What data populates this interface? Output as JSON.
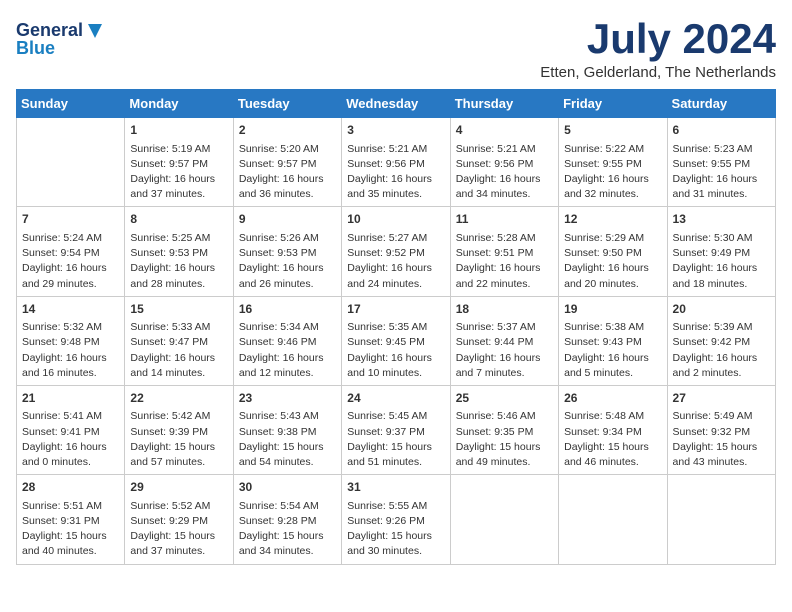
{
  "logo": {
    "line1": "General",
    "line2": "Blue"
  },
  "title": "July 2024",
  "location": "Etten, Gelderland, The Netherlands",
  "weekdays": [
    "Sunday",
    "Monday",
    "Tuesday",
    "Wednesday",
    "Thursday",
    "Friday",
    "Saturday"
  ],
  "weeks": [
    [
      {
        "day": "",
        "content": ""
      },
      {
        "day": "1",
        "content": "Sunrise: 5:19 AM\nSunset: 9:57 PM\nDaylight: 16 hours\nand 37 minutes."
      },
      {
        "day": "2",
        "content": "Sunrise: 5:20 AM\nSunset: 9:57 PM\nDaylight: 16 hours\nand 36 minutes."
      },
      {
        "day": "3",
        "content": "Sunrise: 5:21 AM\nSunset: 9:56 PM\nDaylight: 16 hours\nand 35 minutes."
      },
      {
        "day": "4",
        "content": "Sunrise: 5:21 AM\nSunset: 9:56 PM\nDaylight: 16 hours\nand 34 minutes."
      },
      {
        "day": "5",
        "content": "Sunrise: 5:22 AM\nSunset: 9:55 PM\nDaylight: 16 hours\nand 32 minutes."
      },
      {
        "day": "6",
        "content": "Sunrise: 5:23 AM\nSunset: 9:55 PM\nDaylight: 16 hours\nand 31 minutes."
      }
    ],
    [
      {
        "day": "7",
        "content": "Sunrise: 5:24 AM\nSunset: 9:54 PM\nDaylight: 16 hours\nand 29 minutes."
      },
      {
        "day": "8",
        "content": "Sunrise: 5:25 AM\nSunset: 9:53 PM\nDaylight: 16 hours\nand 28 minutes."
      },
      {
        "day": "9",
        "content": "Sunrise: 5:26 AM\nSunset: 9:53 PM\nDaylight: 16 hours\nand 26 minutes."
      },
      {
        "day": "10",
        "content": "Sunrise: 5:27 AM\nSunset: 9:52 PM\nDaylight: 16 hours\nand 24 minutes."
      },
      {
        "day": "11",
        "content": "Sunrise: 5:28 AM\nSunset: 9:51 PM\nDaylight: 16 hours\nand 22 minutes."
      },
      {
        "day": "12",
        "content": "Sunrise: 5:29 AM\nSunset: 9:50 PM\nDaylight: 16 hours\nand 20 minutes."
      },
      {
        "day": "13",
        "content": "Sunrise: 5:30 AM\nSunset: 9:49 PM\nDaylight: 16 hours\nand 18 minutes."
      }
    ],
    [
      {
        "day": "14",
        "content": "Sunrise: 5:32 AM\nSunset: 9:48 PM\nDaylight: 16 hours\nand 16 minutes."
      },
      {
        "day": "15",
        "content": "Sunrise: 5:33 AM\nSunset: 9:47 PM\nDaylight: 16 hours\nand 14 minutes."
      },
      {
        "day": "16",
        "content": "Sunrise: 5:34 AM\nSunset: 9:46 PM\nDaylight: 16 hours\nand 12 minutes."
      },
      {
        "day": "17",
        "content": "Sunrise: 5:35 AM\nSunset: 9:45 PM\nDaylight: 16 hours\nand 10 minutes."
      },
      {
        "day": "18",
        "content": "Sunrise: 5:37 AM\nSunset: 9:44 PM\nDaylight: 16 hours\nand 7 minutes."
      },
      {
        "day": "19",
        "content": "Sunrise: 5:38 AM\nSunset: 9:43 PM\nDaylight: 16 hours\nand 5 minutes."
      },
      {
        "day": "20",
        "content": "Sunrise: 5:39 AM\nSunset: 9:42 PM\nDaylight: 16 hours\nand 2 minutes."
      }
    ],
    [
      {
        "day": "21",
        "content": "Sunrise: 5:41 AM\nSunset: 9:41 PM\nDaylight: 16 hours\nand 0 minutes."
      },
      {
        "day": "22",
        "content": "Sunrise: 5:42 AM\nSunset: 9:39 PM\nDaylight: 15 hours\nand 57 minutes."
      },
      {
        "day": "23",
        "content": "Sunrise: 5:43 AM\nSunset: 9:38 PM\nDaylight: 15 hours\nand 54 minutes."
      },
      {
        "day": "24",
        "content": "Sunrise: 5:45 AM\nSunset: 9:37 PM\nDaylight: 15 hours\nand 51 minutes."
      },
      {
        "day": "25",
        "content": "Sunrise: 5:46 AM\nSunset: 9:35 PM\nDaylight: 15 hours\nand 49 minutes."
      },
      {
        "day": "26",
        "content": "Sunrise: 5:48 AM\nSunset: 9:34 PM\nDaylight: 15 hours\nand 46 minutes."
      },
      {
        "day": "27",
        "content": "Sunrise: 5:49 AM\nSunset: 9:32 PM\nDaylight: 15 hours\nand 43 minutes."
      }
    ],
    [
      {
        "day": "28",
        "content": "Sunrise: 5:51 AM\nSunset: 9:31 PM\nDaylight: 15 hours\nand 40 minutes."
      },
      {
        "day": "29",
        "content": "Sunrise: 5:52 AM\nSunset: 9:29 PM\nDaylight: 15 hours\nand 37 minutes."
      },
      {
        "day": "30",
        "content": "Sunrise: 5:54 AM\nSunset: 9:28 PM\nDaylight: 15 hours\nand 34 minutes."
      },
      {
        "day": "31",
        "content": "Sunrise: 5:55 AM\nSunset: 9:26 PM\nDaylight: 15 hours\nand 30 minutes."
      },
      {
        "day": "",
        "content": ""
      },
      {
        "day": "",
        "content": ""
      },
      {
        "day": "",
        "content": ""
      }
    ]
  ]
}
